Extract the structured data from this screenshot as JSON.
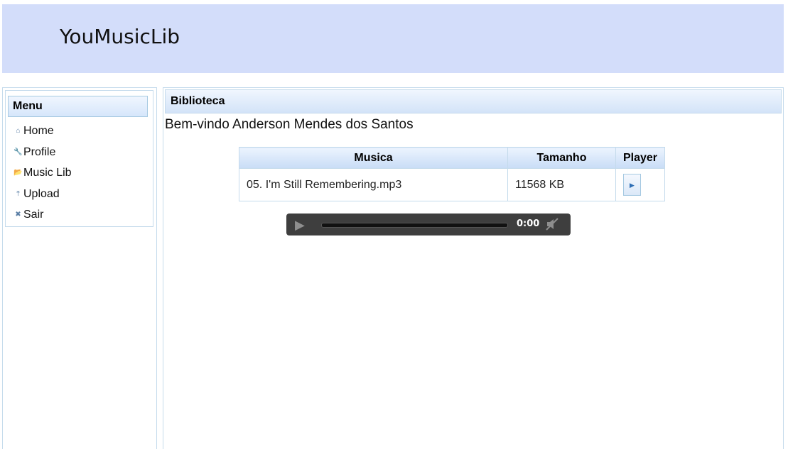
{
  "header": {
    "title": "YouMusicLib"
  },
  "menu": {
    "title": "Menu",
    "items": [
      {
        "label": "Home",
        "icon": "⌂"
      },
      {
        "label": "Profile",
        "icon": "🔧"
      },
      {
        "label": "Music Lib",
        "icon": "📂"
      },
      {
        "label": "Upload",
        "icon": "⤒"
      },
      {
        "label": "Sair",
        "icon": "✖"
      }
    ]
  },
  "main": {
    "title": "Biblioteca",
    "welcome": "Bem-vindo Anderson Mendes dos Santos",
    "table": {
      "columns": [
        "Musica",
        "Tamanho",
        "Player"
      ],
      "rows": [
        {
          "musica": "05. I'm Still Remembering.mp3",
          "tamanho": "11568 KB"
        }
      ]
    },
    "player": {
      "time": "0:00"
    }
  }
}
